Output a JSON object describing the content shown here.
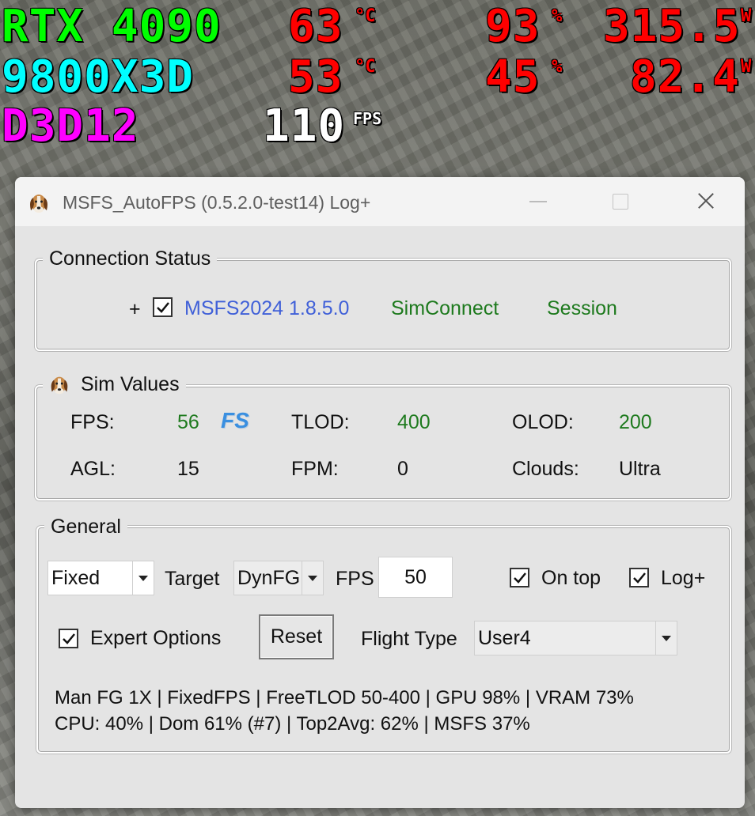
{
  "osd": {
    "gpu": {
      "name": "RTX 4090",
      "temp": "63",
      "temp_unit": "°C",
      "load": "93",
      "load_unit": "%",
      "power": "315.5",
      "power_unit": "W"
    },
    "cpu": {
      "name": "9800X3D",
      "temp": "53",
      "temp_unit": "°C",
      "load": "45",
      "load_unit": "%",
      "power": "82.4",
      "power_unit": "W"
    },
    "api": {
      "name": "D3D12",
      "fps": "110",
      "fps_unit": "FPS"
    },
    "colors": {
      "gpu": "#00ff00",
      "cpu": "#00ffff",
      "api": "#ff00ff",
      "values": "#ff0000",
      "fps": "#ffffff"
    }
  },
  "window": {
    "title": "MSFS_AutoFPS (0.5.2.0-test14) Log+",
    "icon": "beagle-icon",
    "controls": [
      "minimize-icon",
      "maximize-icon",
      "close-icon"
    ]
  },
  "connection": {
    "title": "Connection Status",
    "expand": "+",
    "checked": true,
    "sim": "MSFS2024 1.8.5.0",
    "simconnect": "SimConnect",
    "session": "Session",
    "colors": {
      "sim": "#4060d8",
      "ok": "#1e7a1e"
    }
  },
  "sim_values": {
    "title": "Sim Values",
    "fps_label": "FPS:",
    "fps": "56",
    "fs_badge": "FS",
    "tlod_label": "TLOD:",
    "tlod": "400",
    "olod_label": "OLOD:",
    "olod": "200",
    "agl_label": "AGL:",
    "agl": "15",
    "fpm_label": "FPM:",
    "fpm": "0",
    "clouds_label": "Clouds:",
    "clouds": "Ultra"
  },
  "general": {
    "title": "General",
    "mode": "Fixed",
    "target_label": "Target",
    "target": "DynFG",
    "fps_label": "FPS",
    "fps_value": "50",
    "on_top_label": "On top",
    "on_top": true,
    "log_label": "Log+",
    "log": true,
    "expert_label": "Expert Options",
    "expert": true,
    "reset_label": "Reset",
    "flight_type_label": "Flight Type",
    "flight_type": "User4",
    "status_line1": "Man FG 1X | FixedFPS | FreeTLOD 50-400 | GPU 98% | VRAM 73%",
    "status_line2": "CPU: 40% | Dom 61% (#7) | Top2Avg: 62% | MSFS 37%"
  }
}
